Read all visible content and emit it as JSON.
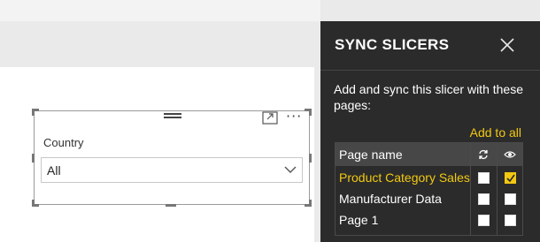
{
  "slicer": {
    "field_label": "Country",
    "selected_value": "All"
  },
  "sync_pane": {
    "title": "SYNC SLICERS",
    "description": "Add and sync this slicer with these pages:",
    "add_to_all": "Add to all",
    "table": {
      "header_page_name": "Page name",
      "rows": [
        {
          "name": "Product Category Sales",
          "sync": false,
          "visible": true,
          "active": true
        },
        {
          "name": "Manufacturer Data",
          "sync": false,
          "visible": false,
          "active": false
        },
        {
          "name": "Page 1",
          "sync": false,
          "visible": false,
          "active": false
        }
      ]
    }
  },
  "colors": {
    "accent": "#f2c811",
    "pane_background": "#2b2b2b",
    "header_background": "#474747"
  },
  "icons": {
    "close": "close-icon",
    "sync_column": "sync-icon",
    "visibility_column": "eye-icon",
    "focus_mode": "focus-mode-icon",
    "more_options": "more-options-icon",
    "drag_grip": "drag-grip-icon",
    "dropdown": "chevron-down-icon"
  }
}
